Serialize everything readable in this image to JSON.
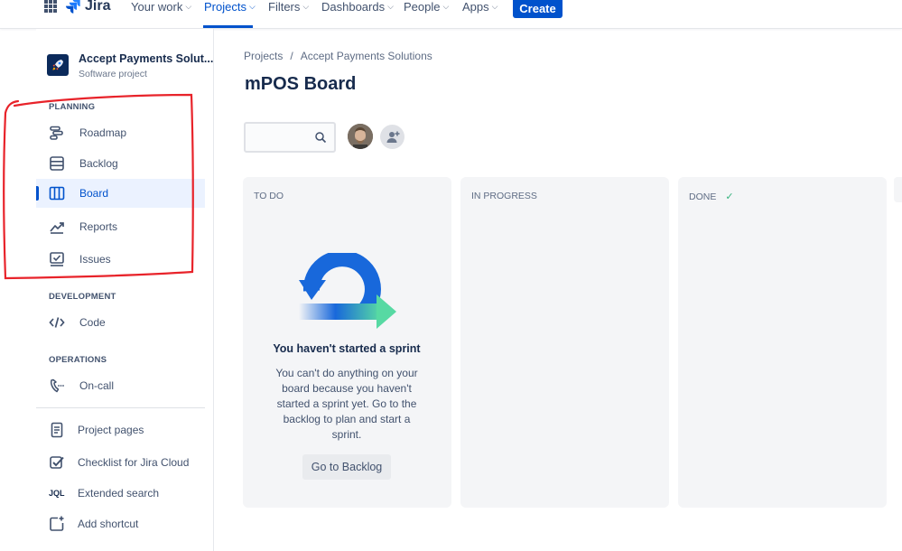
{
  "topnav": {
    "logo_text": "Jira",
    "items": [
      {
        "label": "Your work"
      },
      {
        "label": "Projects"
      },
      {
        "label": "Filters"
      },
      {
        "label": "Dashboards"
      },
      {
        "label": "People"
      },
      {
        "label": "Apps"
      }
    ],
    "create_label": "Create",
    "active_item": "Projects"
  },
  "sidebar": {
    "project_name": "Accept Payments Solut...",
    "project_type": "Software project",
    "sections": [
      {
        "heading": "PLANNING",
        "items": [
          {
            "label": "Roadmap",
            "icon": "roadmap-icon"
          },
          {
            "label": "Backlog",
            "icon": "backlog-icon"
          },
          {
            "label": "Board",
            "icon": "board-icon",
            "selected": true
          },
          {
            "label": "Reports",
            "icon": "reports-icon"
          },
          {
            "label": "Issues",
            "icon": "issues-icon"
          }
        ]
      },
      {
        "heading": "DEVELOPMENT",
        "items": [
          {
            "label": "Code",
            "icon": "code-icon"
          }
        ]
      },
      {
        "heading": "OPERATIONS",
        "items": [
          {
            "label": "On-call",
            "icon": "phone-icon"
          }
        ]
      }
    ],
    "extra_items": [
      {
        "label": "Project pages",
        "icon": "page-icon"
      },
      {
        "label": "Checklist for Jira Cloud",
        "icon": "checklist-icon"
      },
      {
        "label": "Extended search",
        "icon": "jql-icon",
        "icon_text": "JQL"
      },
      {
        "label": "Add shortcut",
        "icon": "add-shortcut-icon"
      }
    ]
  },
  "main": {
    "breadcrumb": [
      "Projects",
      "/",
      "Accept Payments Solutions"
    ],
    "title": "mPOS Board",
    "search_placeholder": "",
    "columns": [
      {
        "title": "TO DO"
      },
      {
        "title": "IN PROGRESS"
      },
      {
        "title": "DONE",
        "check": "✓"
      }
    ],
    "empty_state": {
      "title": "You haven't started a sprint",
      "text": "You can't do anything on your board because you haven't started a sprint yet. Go to the backlog to plan and start a sprint.",
      "button_label": "Go to Backlog"
    }
  },
  "colors": {
    "primary": "#0052CC",
    "annotation": "#E8232A",
    "sidebar_selected_bg": "#EBF2FF",
    "column_bg": "#F4F5F7",
    "done_check": "#36B37E"
  }
}
